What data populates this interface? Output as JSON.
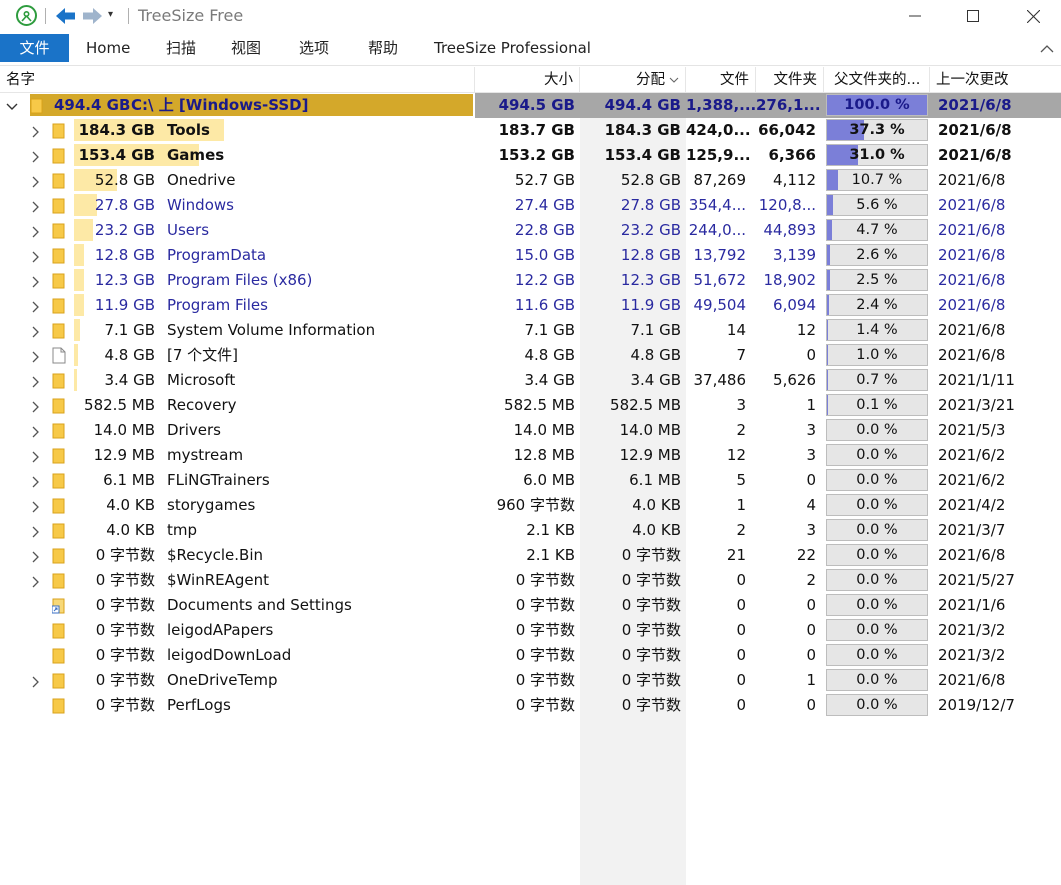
{
  "window": {
    "title": "TreeSize Free",
    "controls": {
      "minimize": "minimize",
      "maximize": "maximize",
      "close": "close"
    }
  },
  "ribbon": {
    "tabs": [
      "文件",
      "Home",
      "扫描",
      "视图",
      "选项",
      "帮助",
      "TreeSize Professional"
    ]
  },
  "columns": {
    "name": "名字",
    "size": "大小",
    "allocated": "分配",
    "files": "文件",
    "folders": "文件夹",
    "percent": "父文件夹的...",
    "last_modified": "上一次更改"
  },
  "colors": {
    "accent": "#1a73c8",
    "root_bar": "#d4a82a",
    "folder_bar": "#fde9a6",
    "percent_fill": "#7b7fd8",
    "link_text": "#2a2aa0"
  },
  "root": {
    "size_label": "494.4 GB",
    "name": "C:\\  上  [Windows-SSD]",
    "size": "494.5 GB",
    "allocated": "494.4 GB",
    "files": "1,388,...",
    "folders": "276,1...",
    "percent": "100.0 %",
    "percent_value": 100.0,
    "date": "2021/6/8"
  },
  "rows": [
    {
      "size_label": "184.3 GB",
      "name": "Tools",
      "size": "183.7 GB",
      "allocated": "184.3 GB",
      "files": "424,0...",
      "folders": "66,042",
      "percent": "37.3 %",
      "pv": 37.3,
      "date": "2021/6/8",
      "style": "bold",
      "expand": true,
      "icon": "folder"
    },
    {
      "size_label": "153.4 GB",
      "name": "Games",
      "size": "153.2 GB",
      "allocated": "153.4 GB",
      "files": "125,9...",
      "folders": "6,366",
      "percent": "31.0 %",
      "pv": 31.0,
      "date": "2021/6/8",
      "style": "bold",
      "expand": true,
      "icon": "folder"
    },
    {
      "size_label": "52.8 GB",
      "name": "Onedrive",
      "size": "52.7 GB",
      "allocated": "52.8 GB",
      "files": "87,269",
      "folders": "4,112",
      "percent": "10.7 %",
      "pv": 10.7,
      "date": "2021/6/8",
      "style": "black",
      "expand": true,
      "icon": "folder"
    },
    {
      "size_label": "27.8 GB",
      "name": "Windows",
      "size": "27.4 GB",
      "allocated": "27.8 GB",
      "files": "354,4...",
      "folders": "120,8...",
      "percent": "5.6 %",
      "pv": 5.6,
      "date": "2021/6/8",
      "style": "blue",
      "expand": true,
      "icon": "folder"
    },
    {
      "size_label": "23.2 GB",
      "name": "Users",
      "size": "22.8 GB",
      "allocated": "23.2 GB",
      "files": "244,0...",
      "folders": "44,893",
      "percent": "4.7 %",
      "pv": 4.7,
      "date": "2021/6/8",
      "style": "blue",
      "expand": true,
      "icon": "folder"
    },
    {
      "size_label": "12.8 GB",
      "name": "ProgramData",
      "size": "15.0 GB",
      "allocated": "12.8 GB",
      "files": "13,792",
      "folders": "3,139",
      "percent": "2.6 %",
      "pv": 2.6,
      "date": "2021/6/8",
      "style": "blue",
      "expand": true,
      "icon": "folder"
    },
    {
      "size_label": "12.3 GB",
      "name": "Program Files (x86)",
      "size": "12.2 GB",
      "allocated": "12.3 GB",
      "files": "51,672",
      "folders": "18,902",
      "percent": "2.5 %",
      "pv": 2.5,
      "date": "2021/6/8",
      "style": "blue",
      "expand": true,
      "icon": "folder"
    },
    {
      "size_label": "11.9 GB",
      "name": "Program Files",
      "size": "11.6 GB",
      "allocated": "11.9 GB",
      "files": "49,504",
      "folders": "6,094",
      "percent": "2.4 %",
      "pv": 2.4,
      "date": "2021/6/8",
      "style": "blue",
      "expand": true,
      "icon": "folder"
    },
    {
      "size_label": "7.1 GB",
      "name": "System Volume Information",
      "size": "7.1 GB",
      "allocated": "7.1 GB",
      "files": "14",
      "folders": "12",
      "percent": "1.4 %",
      "pv": 1.4,
      "date": "2021/6/8",
      "style": "black",
      "expand": true,
      "icon": "folder"
    },
    {
      "size_label": "4.8 GB",
      "name": "[7 个文件]",
      "size": "4.8 GB",
      "allocated": "4.8 GB",
      "files": "7",
      "folders": "0",
      "percent": "1.0 %",
      "pv": 1.0,
      "date": "2021/6/8",
      "style": "black",
      "expand": true,
      "icon": "file"
    },
    {
      "size_label": "3.4 GB",
      "name": "Microsoft",
      "size": "3.4 GB",
      "allocated": "3.4 GB",
      "files": "37,486",
      "folders": "5,626",
      "percent": "0.7 %",
      "pv": 0.7,
      "date": "2021/1/11",
      "style": "black",
      "expand": true,
      "icon": "folder"
    },
    {
      "size_label": "582.5 MB",
      "name": "Recovery",
      "size": "582.5 MB",
      "allocated": "582.5 MB",
      "files": "3",
      "folders": "1",
      "percent": "0.1 %",
      "pv": 0.1,
      "date": "2021/3/21",
      "style": "black",
      "expand": true,
      "icon": "folder"
    },
    {
      "size_label": "14.0 MB",
      "name": "Drivers",
      "size": "14.0 MB",
      "allocated": "14.0 MB",
      "files": "2",
      "folders": "3",
      "percent": "0.0 %",
      "pv": 0.0,
      "date": "2021/5/3",
      "style": "black",
      "expand": true,
      "icon": "folder"
    },
    {
      "size_label": "12.9 MB",
      "name": "mystream",
      "size": "12.8 MB",
      "allocated": "12.9 MB",
      "files": "12",
      "folders": "3",
      "percent": "0.0 %",
      "pv": 0.0,
      "date": "2021/6/2",
      "style": "black",
      "expand": true,
      "icon": "folder"
    },
    {
      "size_label": "6.1 MB",
      "name": "FLiNGTrainers",
      "size": "6.0 MB",
      "allocated": "6.1 MB",
      "files": "5",
      "folders": "0",
      "percent": "0.0 %",
      "pv": 0.0,
      "date": "2021/6/2",
      "style": "black",
      "expand": true,
      "icon": "folder"
    },
    {
      "size_label": "4.0 KB",
      "name": "storygames",
      "size": "960 字节数",
      "allocated": "4.0 KB",
      "files": "1",
      "folders": "4",
      "percent": "0.0 %",
      "pv": 0.0,
      "date": "2021/4/2",
      "style": "black",
      "expand": true,
      "icon": "folder"
    },
    {
      "size_label": "4.0 KB",
      "name": "tmp",
      "size": "2.1 KB",
      "allocated": "4.0 KB",
      "files": "2",
      "folders": "3",
      "percent": "0.0 %",
      "pv": 0.0,
      "date": "2021/3/7",
      "style": "black",
      "expand": true,
      "icon": "folder"
    },
    {
      "size_label": "0 字节数",
      "name": "$Recycle.Bin",
      "size": "2.1 KB",
      "allocated": "0 字节数",
      "files": "21",
      "folders": "22",
      "percent": "0.0 %",
      "pv": 0.0,
      "date": "2021/6/8",
      "style": "black",
      "expand": true,
      "icon": "folder"
    },
    {
      "size_label": "0 字节数",
      "name": "$WinREAgent",
      "size": "0 字节数",
      "allocated": "0 字节数",
      "files": "0",
      "folders": "2",
      "percent": "0.0 %",
      "pv": 0.0,
      "date": "2021/5/27",
      "style": "black",
      "expand": true,
      "icon": "folder"
    },
    {
      "size_label": "0 字节数",
      "name": "Documents and Settings",
      "size": "0 字节数",
      "allocated": "0 字节数",
      "files": "0",
      "folders": "0",
      "percent": "0.0 %",
      "pv": 0.0,
      "date": "2021/1/6",
      "style": "black",
      "expand": false,
      "icon": "shortcut"
    },
    {
      "size_label": "0 字节数",
      "name": "leigodAPapers",
      "size": "0 字节数",
      "allocated": "0 字节数",
      "files": "0",
      "folders": "0",
      "percent": "0.0 %",
      "pv": 0.0,
      "date": "2021/3/2",
      "style": "black",
      "expand": false,
      "icon": "folder"
    },
    {
      "size_label": "0 字节数",
      "name": "leigodDownLoad",
      "size": "0 字节数",
      "allocated": "0 字节数",
      "files": "0",
      "folders": "0",
      "percent": "0.0 %",
      "pv": 0.0,
      "date": "2021/3/2",
      "style": "black",
      "expand": false,
      "icon": "folder"
    },
    {
      "size_label": "0 字节数",
      "name": "OneDriveTemp",
      "size": "0 字节数",
      "allocated": "0 字节数",
      "files": "0",
      "folders": "1",
      "percent": "0.0 %",
      "pv": 0.0,
      "date": "2021/6/8",
      "style": "black",
      "expand": true,
      "icon": "folder"
    },
    {
      "size_label": "0 字节数",
      "name": "PerfLogs",
      "size": "0 字节数",
      "allocated": "0 字节数",
      "files": "0",
      "folders": "0",
      "percent": "0.0 %",
      "pv": 0.0,
      "date": "2019/12/7",
      "style": "black",
      "expand": false,
      "icon": "folder"
    }
  ]
}
